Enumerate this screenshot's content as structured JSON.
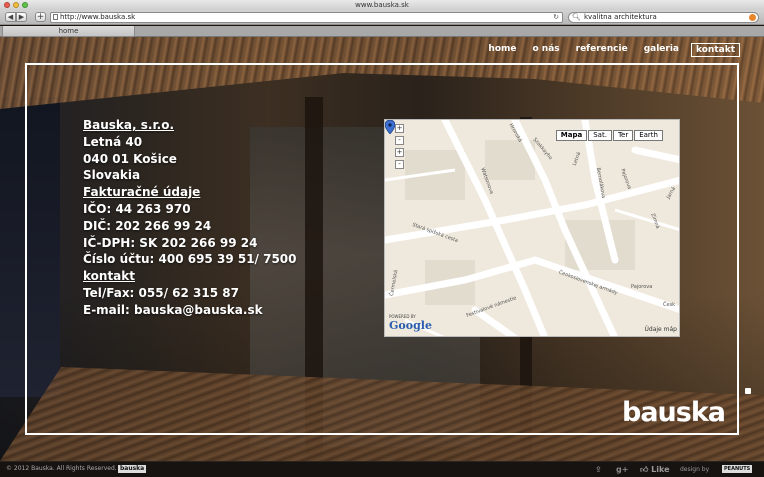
{
  "browser": {
    "window_title": "www.bauska.sk",
    "url": "http://www.bauska.sk",
    "search_query": "kvalitna architektura",
    "tab_label": "home"
  },
  "nav": {
    "items": [
      "home",
      "o nás",
      "referencie",
      "galeria",
      "kontakt"
    ],
    "active": "kontakt"
  },
  "contact": {
    "company": "Bauska, s.r.o.",
    "street": "Letná 40",
    "city": "040 01 Košice",
    "country": "Slovakia",
    "billing_heading": "Fakturačné údaje",
    "ico": "IČO: 44 263 970",
    "dic": "DIČ: 202 266 99 24",
    "ic_dph": "IČ-DPH: SK 202 266 99 24",
    "account": "Číslo účtu: 400 695 39 51/ 7500",
    "contact_heading": "kontakt",
    "tel_fax": "Tel/Fax: 055/ 62 315 87",
    "email": "E-mail: bauska@bauska.sk"
  },
  "map": {
    "types": [
      "Mapa",
      "Sat.",
      "Ter",
      "Earth"
    ],
    "selected_type": "Mapa",
    "zoom_controls": [
      "+",
      "-",
      "+",
      "-"
    ],
    "powered_by": "POWERED BY",
    "brand": "Google",
    "data_label": "Údaje máp",
    "streets": [
      "Letná",
      "Hronská",
      "Szakkayho",
      "Watsonova",
      "Jarná",
      "Bernolákova",
      "Pajorova",
      "Zimná",
      "Česk",
      "Čermelská",
      "Stará spišská cesta",
      "Čeokoslovenskej armády",
      "Festivalové námestie",
      "Pajorova"
    ]
  },
  "logo": {
    "text": "bauska"
  },
  "footer": {
    "copyright": "© 2012 Bauska. All Rights Reserved.",
    "mini_logo": "bauska",
    "like": "Like",
    "gplus": "g+",
    "design_by": "design by",
    "designer": "PEANUTS"
  },
  "colors": {
    "frame": "#ffffff",
    "text": "#ffffff",
    "footer_bg": "#171310",
    "map_bg": "#efe9dd",
    "marker": "#3d6fd0"
  }
}
